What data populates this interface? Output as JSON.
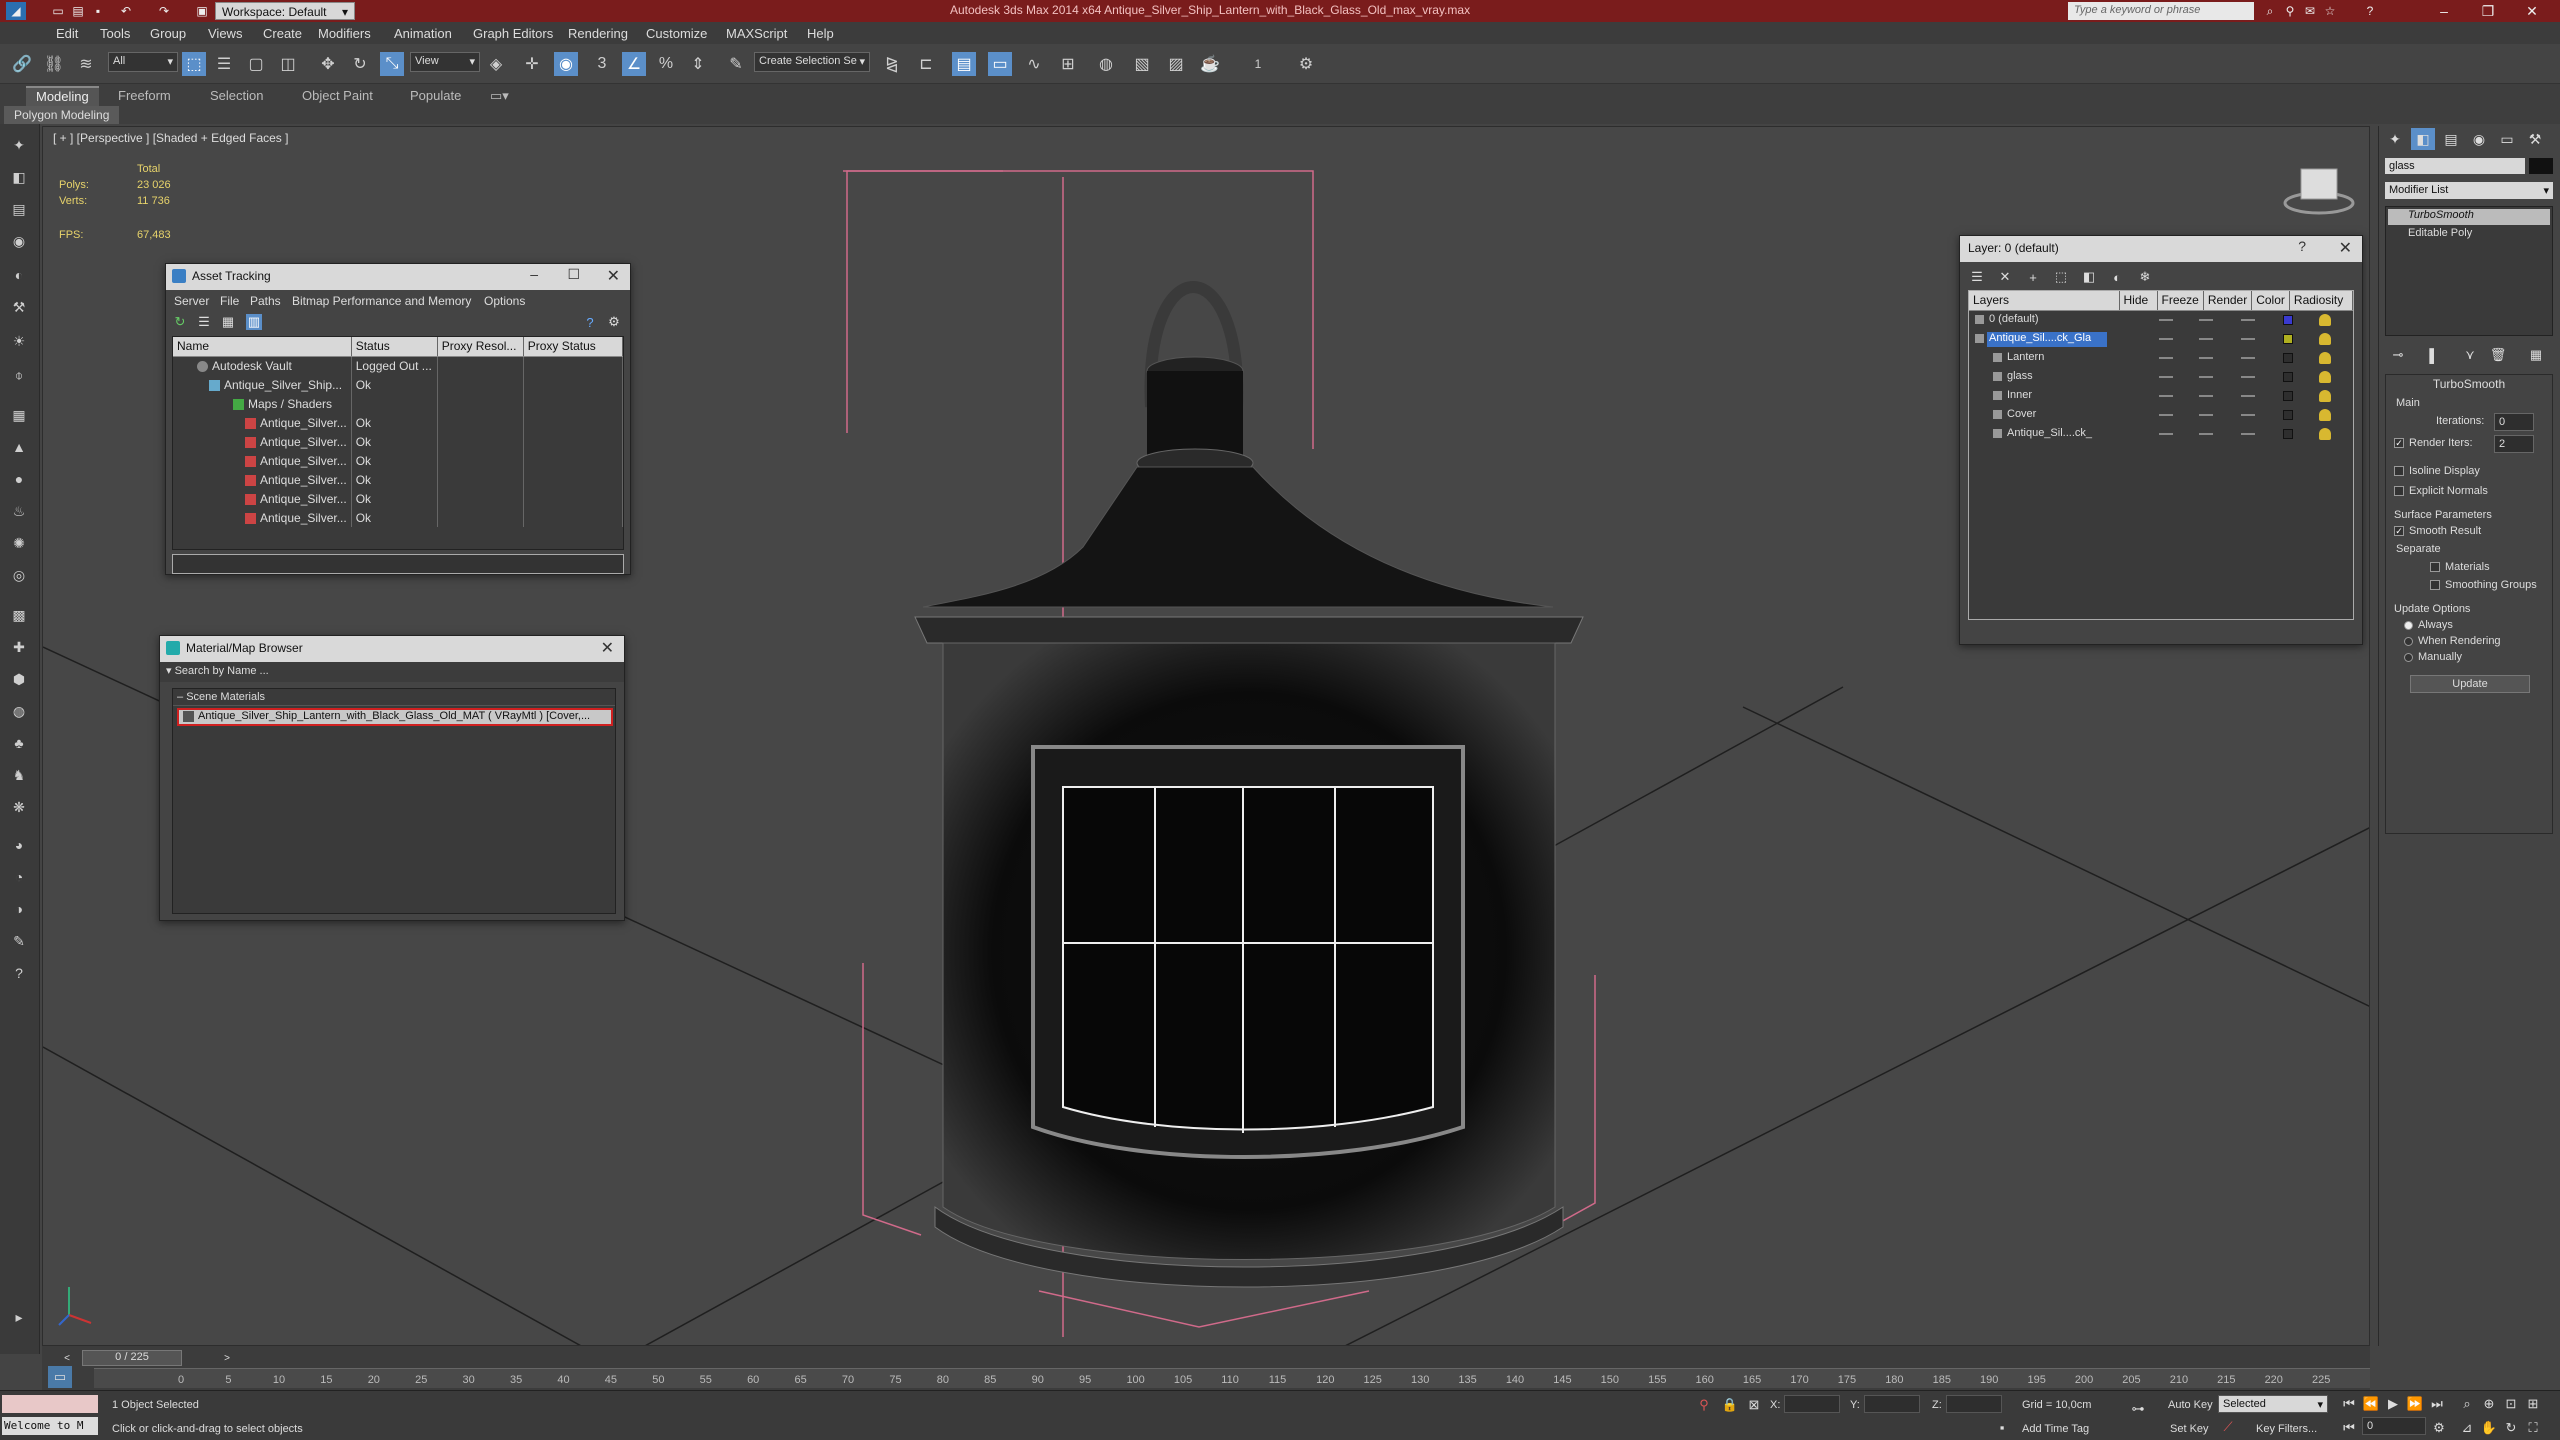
{
  "window": {
    "title": "Autodesk 3ds Max  2014 x64      Antique_Silver_Ship_Lantern_with_Black_Glass_Old_max_vray.max",
    "workspace": "Workspace: Default",
    "search_placeholder": "Type a keyword or phrase"
  },
  "menu": [
    "Edit",
    "Tools",
    "Group",
    "Views",
    "Create",
    "Modifiers",
    "Animation",
    "Graph Editors",
    "Rendering",
    "Customize",
    "MAXScript",
    "Help"
  ],
  "toolbar": {
    "filter": "All",
    "ref_coord": "View",
    "angle_snap_value": "1",
    "named_selection": "Create Selection Se"
  },
  "ribbon": {
    "tabs": [
      "Modeling",
      "Freeform",
      "Selection",
      "Object Paint",
      "Populate"
    ],
    "sub_label": "Polygon Modeling"
  },
  "viewport": {
    "label": "[ + ] [Perspective ] [Shaded + Edged Faces ]",
    "stats": {
      "total_label": "Total",
      "polys_label": "Polys:",
      "polys": "23 026",
      "verts_label": "Verts:",
      "verts": "11 736",
      "fps_label": "FPS:",
      "fps": "67,483"
    }
  },
  "asset_tracking": {
    "title": "Asset Tracking",
    "menu": [
      "Server",
      "File",
      "Paths",
      "Bitmap Performance and Memory",
      "Options"
    ],
    "columns": [
      "Name",
      "Status",
      "Proxy Resol...",
      "Proxy Status"
    ],
    "rows": [
      {
        "name": "Autodesk Vault",
        "status": "Logged Out ...",
        "indent": 0
      },
      {
        "name": "Antique_Silver_Ship...",
        "status": "Ok",
        "indent": 1
      },
      {
        "name": "Maps / Shaders",
        "status": "",
        "indent": 2
      },
      {
        "name": "Antique_Silver...",
        "status": "Ok",
        "indent": 3
      },
      {
        "name": "Antique_Silver...",
        "status": "Ok",
        "indent": 3
      },
      {
        "name": "Antique_Silver...",
        "status": "Ok",
        "indent": 3
      },
      {
        "name": "Antique_Silver...",
        "status": "Ok",
        "indent": 3
      },
      {
        "name": "Antique_Silver...",
        "status": "Ok",
        "indent": 3
      },
      {
        "name": "Antique_Silver...",
        "status": "Ok",
        "indent": 3
      }
    ]
  },
  "material_browser": {
    "title": "Material/Map Browser",
    "search_placeholder": "Search by Name ...",
    "group": "Scene Materials",
    "item": "Antique_Silver_Ship_Lantern_with_Black_Glass_Old_MAT ( VRayMtl ) [Cover,..."
  },
  "layer_dialog": {
    "title": "Layer: 0 (default)",
    "columns": [
      "Layers",
      "Hide",
      "Freeze",
      "Render",
      "Color",
      "Radiosity"
    ],
    "rows": [
      {
        "name": "0 (default)",
        "color": "#3a3ad0",
        "indent": 0,
        "selected": false
      },
      {
        "name": "Antique_Sil....ck_Gla",
        "color": "#b0b020",
        "indent": 0,
        "selected": true
      },
      {
        "name": "Lantern",
        "color": "#2e2e2e",
        "indent": 1,
        "selected": false
      },
      {
        "name": "glass",
        "color": "#2e2e2e",
        "indent": 1,
        "selected": false
      },
      {
        "name": "Inner",
        "color": "#2e2e2e",
        "indent": 1,
        "selected": false
      },
      {
        "name": "Cover",
        "color": "#2e2e2e",
        "indent": 1,
        "selected": false
      },
      {
        "name": "Antique_Sil....ck_",
        "color": "#2e2e2e",
        "indent": 1,
        "selected": false
      }
    ]
  },
  "command_panel": {
    "object_name": "glass",
    "modifier_list": "Modifier List",
    "stack": [
      "TurboSmooth",
      "Editable Poly"
    ],
    "rollout": "TurboSmooth",
    "main_label": "Main",
    "iterations_label": "Iterations:",
    "iterations": "0",
    "render_iters_label": "Render Iters:",
    "render_iters": "2",
    "isoline": "Isoline Display",
    "explicit_normals": "Explicit Normals",
    "surface_params": "Surface Parameters",
    "smooth_result": "Smooth Result",
    "separate": "Separate",
    "materials": "Materials",
    "smoothing_groups": "Smoothing Groups",
    "update_options": "Update Options",
    "always": "Always",
    "when_rendering": "When Rendering",
    "manually": "Manually",
    "update_button": "Update"
  },
  "timeline": {
    "frame": "0 / 225",
    "ticks": [
      "0",
      "5",
      "10",
      "15",
      "20",
      "25",
      "30",
      "35",
      "40",
      "45",
      "50",
      "55",
      "60",
      "65",
      "70",
      "75",
      "80",
      "85",
      "90",
      "95",
      "100",
      "105",
      "110",
      "115",
      "120",
      "125",
      "130",
      "135",
      "140",
      "145",
      "150",
      "155",
      "160",
      "165",
      "170",
      "175",
      "180",
      "185",
      "190",
      "195",
      "200",
      "205",
      "210",
      "215",
      "220",
      "225"
    ]
  },
  "status": {
    "maxscript": "Welcome to M",
    "selected": "1 Object Selected",
    "prompt": "Click or click-and-drag to select objects",
    "x_label": "X:",
    "y_label": "Y:",
    "z_label": "Z:",
    "grid": "Grid = 10,0cm",
    "add_time_tag": "Add Time Tag",
    "auto_key": "Auto Key",
    "set_key": "Set Key",
    "selected_set": "Selected",
    "key_filters": "Key Filters...",
    "frame_field": "0"
  }
}
